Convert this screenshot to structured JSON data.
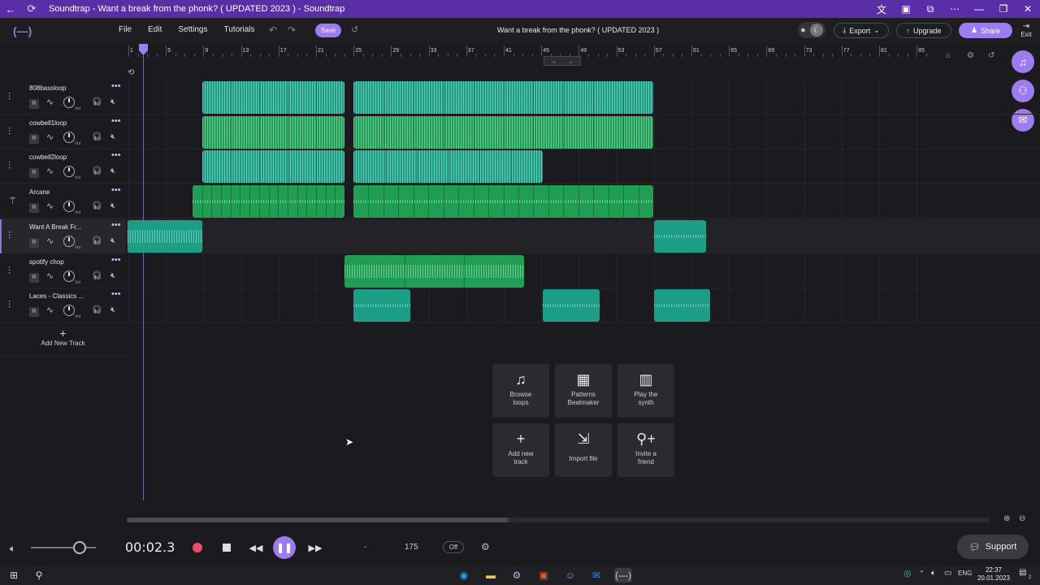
{
  "window": {
    "title": "Soundtrap - Want a break from the phonk? ( UPDATED 2023 ) - Soundtrap"
  },
  "header": {
    "menu": [
      "File",
      "Edit",
      "Settings",
      "Tutorials"
    ],
    "save_label": "Save",
    "song_title": "Want a break from the phonk? ( UPDATED 2023 )",
    "export_label": "Export",
    "upgrade_label": "Upgrade",
    "share_label": "Share",
    "exit_label": "Exit"
  },
  "ruler": {
    "labels": [
      "1",
      "5",
      "9",
      "13",
      "17",
      "21",
      "25",
      "29",
      "33",
      "37",
      "41",
      "45",
      "49",
      "53",
      "57",
      "61",
      "65",
      "69",
      "73",
      "77",
      "81",
      "85"
    ]
  },
  "tracks": [
    {
      "name": "808bassloop",
      "r": "R",
      "vol": "Vol",
      "icon": "waveform-icon",
      "active": false
    },
    {
      "name": "cowbell1loop",
      "r": "R",
      "vol": "Vol",
      "icon": "waveform-icon",
      "active": false
    },
    {
      "name": "cowbell2loop",
      "r": "R",
      "vol": "Vol",
      "icon": "waveform-icon",
      "active": false
    },
    {
      "name": "Arcane",
      "r": "R",
      "vol": "Vol",
      "icon": "synth-icon",
      "active": false
    },
    {
      "name": "Want A Break Fr...",
      "r": "R",
      "vol": "Vol",
      "icon": "waveform-icon",
      "active": true
    },
    {
      "name": "spotify chop",
      "r": "R",
      "vol": "Vol",
      "icon": "waveform-icon",
      "active": false
    },
    {
      "name": "Laces - Classics ...",
      "r": "R",
      "vol": "Vol",
      "icon": "waveform-icon",
      "active": false
    }
  ],
  "add_track_label": "Add New Track",
  "quick_start": [
    {
      "lines": [
        "Browse",
        "loops"
      ],
      "icon": "music-note-icon"
    },
    {
      "lines": [
        "Patterns",
        "Beatmaker"
      ],
      "icon": "pattern-grid-icon"
    },
    {
      "lines": [
        "Play the",
        "synth"
      ],
      "icon": "piano-icon"
    },
    {
      "lines": [
        "Add new",
        "track"
      ],
      "icon": "plus-icon"
    },
    {
      "lines": [
        "Import file"
      ],
      "icon": "import-icon"
    },
    {
      "lines": [
        "Invite a",
        "friend"
      ],
      "icon": "invite-icon"
    }
  ],
  "transport": {
    "time": "00:02.3",
    "key": "-",
    "bpm": "175",
    "metronome": "Off",
    "volume_fraction": 0.75
  },
  "support_label": "Support",
  "taskbar": {
    "lang": "ENG",
    "time": "22:37",
    "date": "20.01.2023",
    "notifications": "2"
  },
  "colors": {
    "accent": "#9d7cf0",
    "titlebar": "#5a2ea6",
    "clip_teal": "#1c9d86",
    "clip_green": "#1f9e54",
    "record": "#ee4a6a"
  }
}
